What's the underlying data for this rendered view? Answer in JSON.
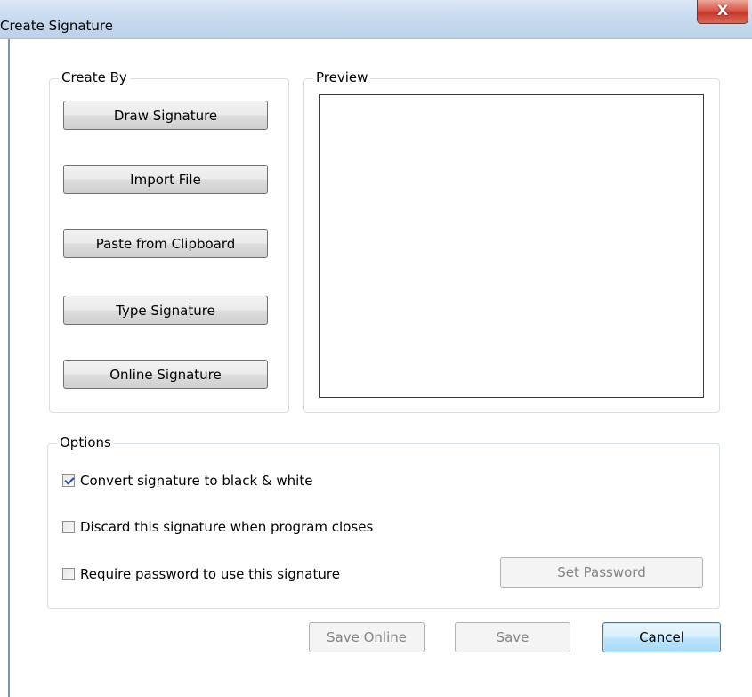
{
  "window": {
    "title": "Create Signature",
    "close_glyph": "X"
  },
  "create_by": {
    "legend": "Create By",
    "buttons": [
      {
        "label": "Draw Signature"
      },
      {
        "label": "Import File"
      },
      {
        "label": "Paste from Clipboard"
      },
      {
        "label": "Type Signature"
      },
      {
        "label": "Online Signature"
      }
    ]
  },
  "preview": {
    "legend": "Preview"
  },
  "options": {
    "legend": "Options",
    "items": [
      {
        "label": "Convert signature to black & white",
        "checked": true
      },
      {
        "label": "Discard this signature when program closes",
        "checked": false
      },
      {
        "label": "Require password to use this signature",
        "checked": false
      }
    ],
    "set_password_label": "Set Password"
  },
  "footer": {
    "save_online_label": "Save Online",
    "save_label": "Save",
    "cancel_label": "Cancel"
  }
}
